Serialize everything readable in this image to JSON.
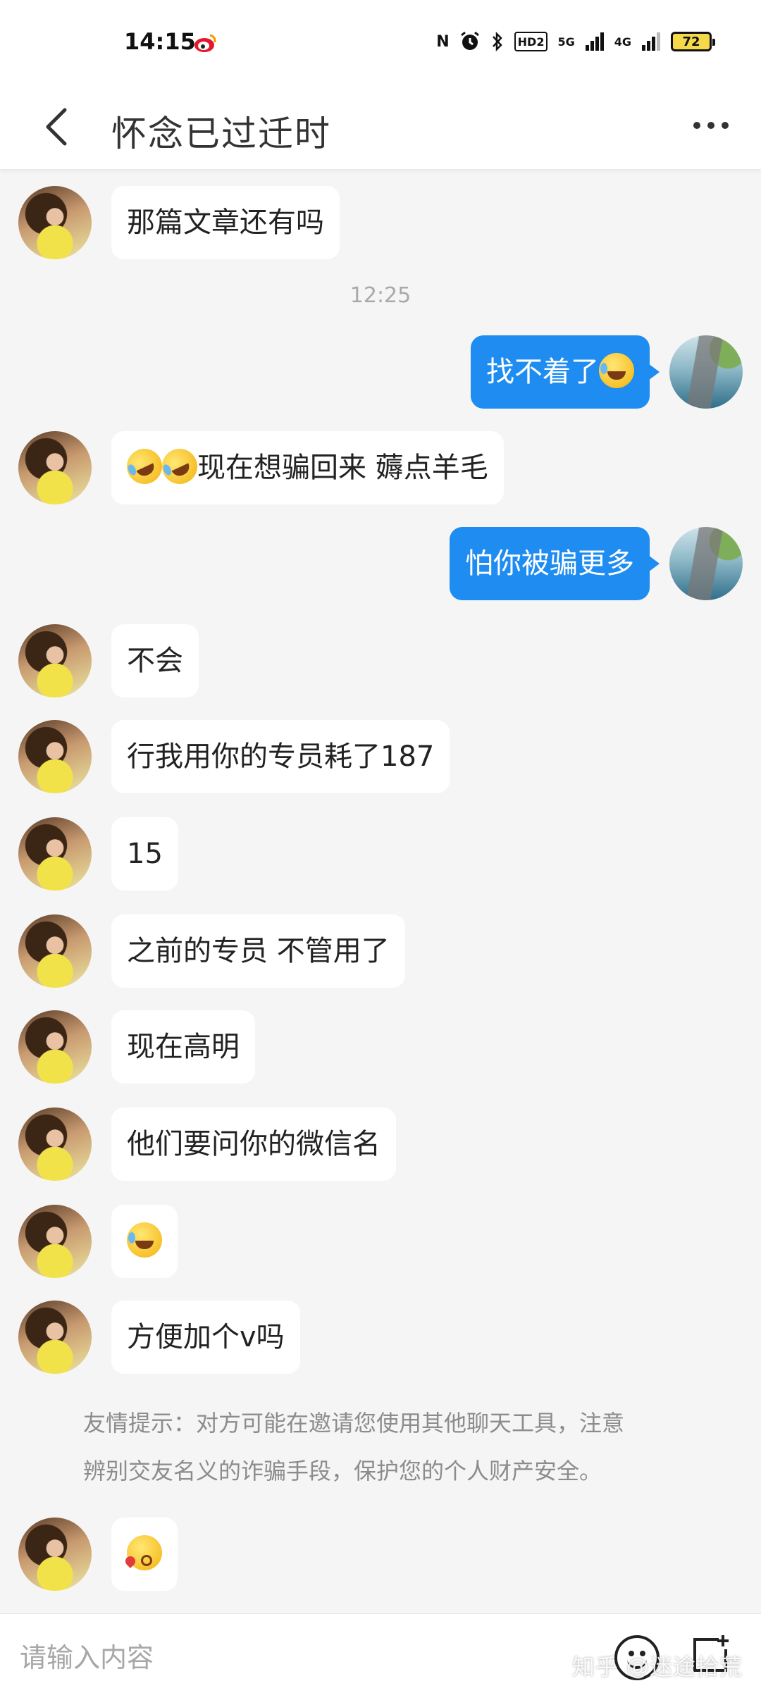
{
  "status_bar": {
    "time": "14:15",
    "nfc": "N",
    "hd": "HD2",
    "net_5g": "5G",
    "net_4g": "4G",
    "battery": "72"
  },
  "header": {
    "title": "怀念已过迁时"
  },
  "chat": {
    "messages": [
      {
        "side": "left",
        "text": "那篇文章还有吗"
      },
      {
        "side": "right",
        "text": "找不着了",
        "emoji": "laughing-crying"
      },
      {
        "side": "left",
        "emoji": "rolling-laughing x2",
        "text": "现在想骗回来 薅点羊毛"
      },
      {
        "side": "right",
        "text": "怕你被骗更多"
      },
      {
        "side": "left",
        "text": "不会"
      },
      {
        "side": "left",
        "text": "行我用你的专员耗了187"
      },
      {
        "side": "left",
        "text": "15"
      },
      {
        "side": "left",
        "text": "之前的专员 不管用了"
      },
      {
        "side": "left",
        "text": "现在高明"
      },
      {
        "side": "left",
        "text": "他们要问你的微信名"
      },
      {
        "side": "left",
        "emoji": "laughing-crying"
      },
      {
        "side": "left",
        "text": "方便加个v吗"
      },
      {
        "side": "left",
        "emoji": "kissing"
      }
    ],
    "timestamp": "12:25",
    "notice_line1": "友情提示：对方可能在邀请您使用其他聊天工具，注意",
    "notice_line2": "辨别交友名义的诈骗手段，保护您的个人财产安全。"
  },
  "input_bar": {
    "placeholder": "请输入内容",
    "watermark": "知乎 @迷途拾荒"
  }
}
